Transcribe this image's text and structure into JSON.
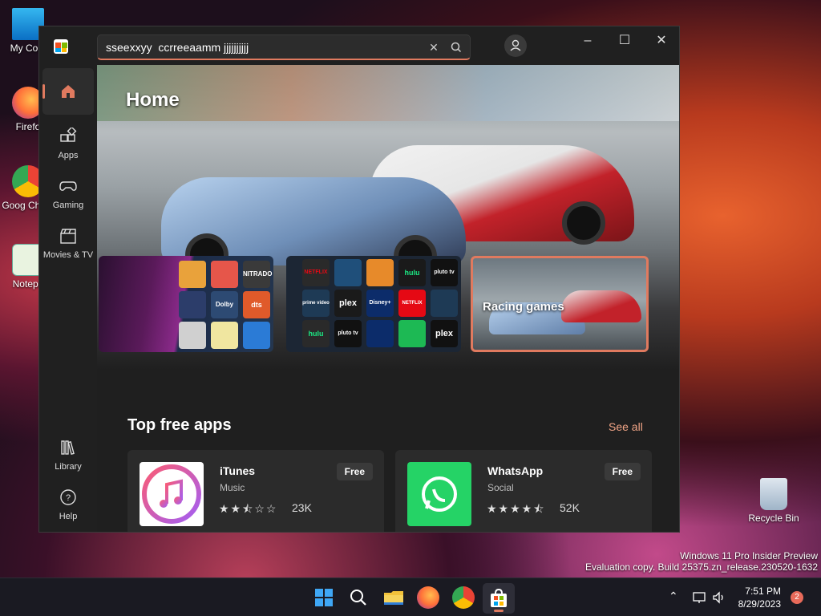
{
  "desktop": {
    "icons": [
      {
        "label": "My Com"
      },
      {
        "label": "Firefo"
      },
      {
        "label": "Goog Chron"
      },
      {
        "label": "Notepa"
      }
    ],
    "recycle_bin": "Recycle Bin",
    "watermark_line1": "Windows 11 Pro Insider Preview",
    "watermark_line2": "Evaluation copy. Build 25375.zn_release.230520-1632"
  },
  "store": {
    "search_value": "sseexxyy  ccrreeaamm jjjjjjjjjj",
    "nav": [
      {
        "label": "",
        "icon": "home-icon"
      },
      {
        "label": "Apps",
        "icon": "apps-icon"
      },
      {
        "label": "Gaming",
        "icon": "gamepad-icon"
      },
      {
        "label": "Movies & TV",
        "icon": "clapperboard-icon"
      },
      {
        "label": "Library",
        "icon": "library-icon"
      },
      {
        "label": "Help",
        "icon": "help-icon"
      }
    ],
    "hero": {
      "title": "Home",
      "tiles": [
        {
          "label": ""
        },
        {
          "label": ""
        },
        {
          "label": "Racing games"
        }
      ],
      "tile2_logos": [
        "NETFLIX",
        "hulu",
        "pluto tv",
        "prime video",
        "plex",
        "Disney+",
        "NETFLIX",
        "hulu",
        "pluto tv",
        "plex"
      ],
      "tile1_logos": [
        "NITRADO",
        "Dolby",
        "dts"
      ]
    },
    "section": {
      "title": "Top free apps",
      "see_all": "See all"
    },
    "apps": [
      {
        "name": "iTunes",
        "category": "Music",
        "price": "Free",
        "rating": 2.5,
        "stars": "★★⯪☆☆",
        "count": "23K",
        "icon_color": "#ffffff"
      },
      {
        "name": "WhatsApp",
        "category": "Social",
        "price": "Free",
        "rating": 4.5,
        "stars": "★★★★⯪",
        "count": "52K",
        "icon_color": "#25d366"
      }
    ]
  },
  "taskbar": {
    "time": "7:51 PM",
    "date": "8/29/2023",
    "notifications": "2"
  }
}
